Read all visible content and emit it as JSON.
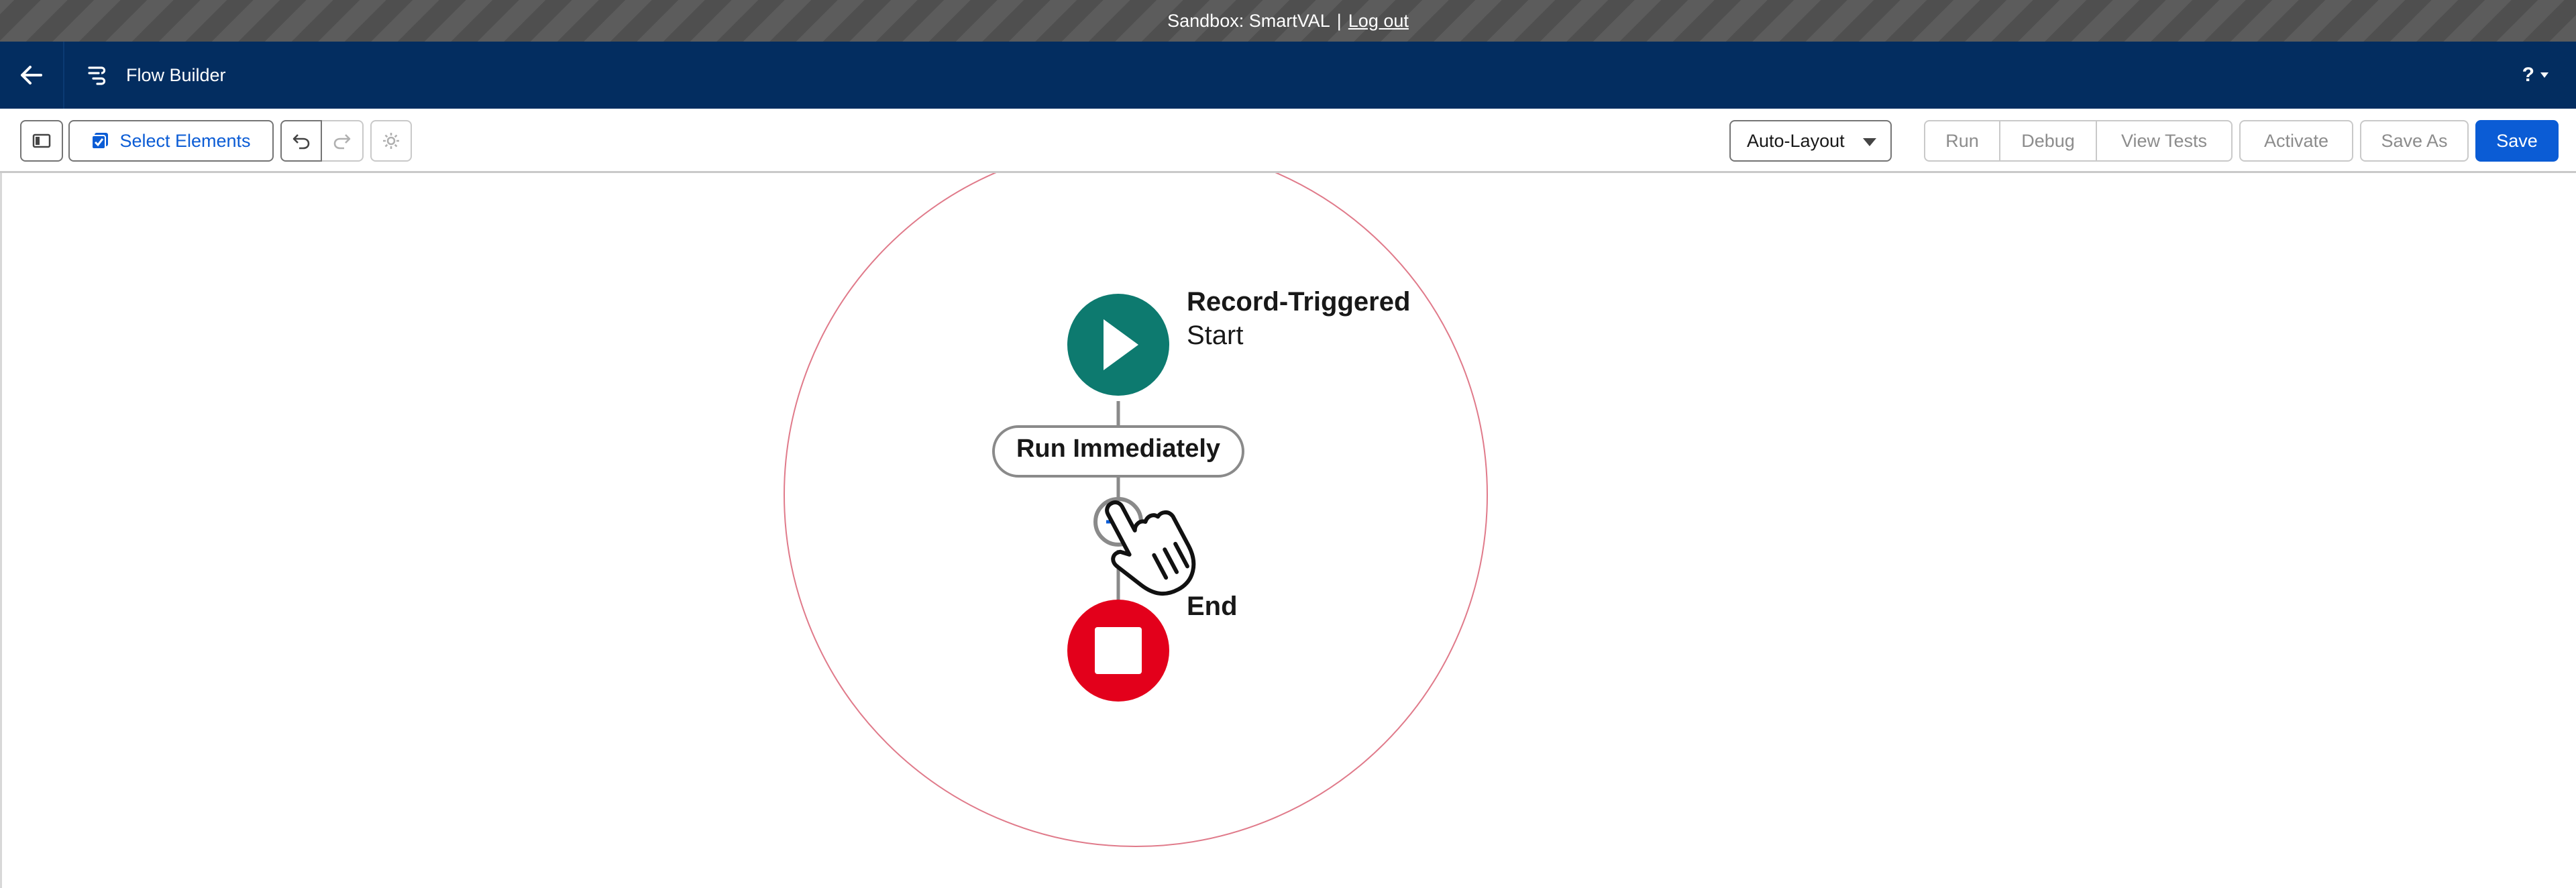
{
  "sandbox_banner": {
    "text": "Sandbox: SmartVAL",
    "separator": "|",
    "logout_label": "Log out"
  },
  "header": {
    "app_title": "Flow Builder",
    "help_label": "?"
  },
  "toolbar": {
    "select_elements_label": "Select Elements",
    "layout_select_value": "Auto-Layout",
    "run_label": "Run",
    "debug_label": "Debug",
    "view_tests_label": "View Tests",
    "activate_label": "Activate",
    "save_as_label": "Save As",
    "save_label": "Save"
  },
  "canvas": {
    "start_node": {
      "title": "Record-Triggered",
      "subtitle": "Start"
    },
    "schedule_path_label": "Run Immediately",
    "end_node": {
      "label": "End"
    }
  },
  "colors": {
    "start_node": "#0d7a6f",
    "end_node": "#e3001b",
    "header_bg": "#032d60",
    "brand": "#0b5cd5",
    "highlight_ring": "#e07a8a"
  },
  "icons": {
    "back": "arrow-left-icon",
    "app": "flow-icon",
    "panel": "toggle-panel-icon",
    "select": "checkbox-icon",
    "undo": "undo-icon",
    "redo": "redo-icon",
    "settings": "gear-icon",
    "dropdown": "caret-down-icon",
    "play": "play-icon",
    "stop": "stop-icon",
    "add": "add-icon",
    "cursor": "hand-pointer-icon"
  }
}
